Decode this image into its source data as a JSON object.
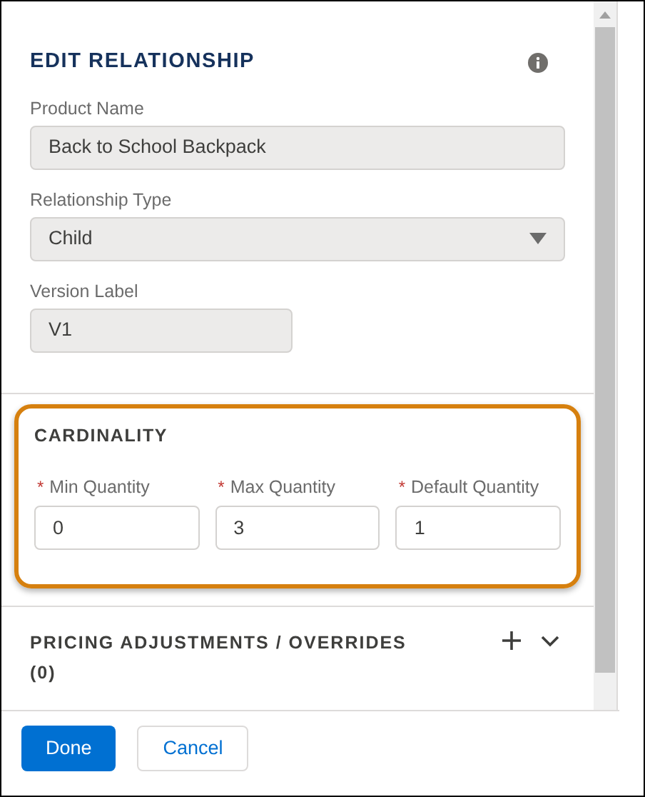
{
  "title": "EDIT RELATIONSHIP",
  "fields": [
    {
      "kind": "text",
      "label": "Product Name",
      "value": "Back to School Backpack"
    },
    {
      "kind": "select",
      "label": "Relationship Type",
      "value": "Child"
    },
    {
      "kind": "short",
      "label": "Version Label",
      "value": "V1"
    }
  ],
  "cardinality": {
    "title": "CARDINALITY",
    "highlighted": true,
    "fields": [
      {
        "label": "Min Quantity",
        "required": true,
        "required_mark": "*",
        "value": "0"
      },
      {
        "label": "Max Quantity",
        "required": true,
        "required_mark": "*",
        "value": "3"
      },
      {
        "label": "Default Quantity",
        "required": true,
        "required_mark": "*",
        "value": "1"
      }
    ]
  },
  "pricing": {
    "title": "PRICING ADJUSTMENTS / OVERRIDES",
    "count": "(0)",
    "expanded": false
  },
  "buttons": [
    {
      "kind": "primary",
      "label": "Done"
    },
    {
      "kind": "neutral",
      "label": "Cancel"
    }
  ]
}
